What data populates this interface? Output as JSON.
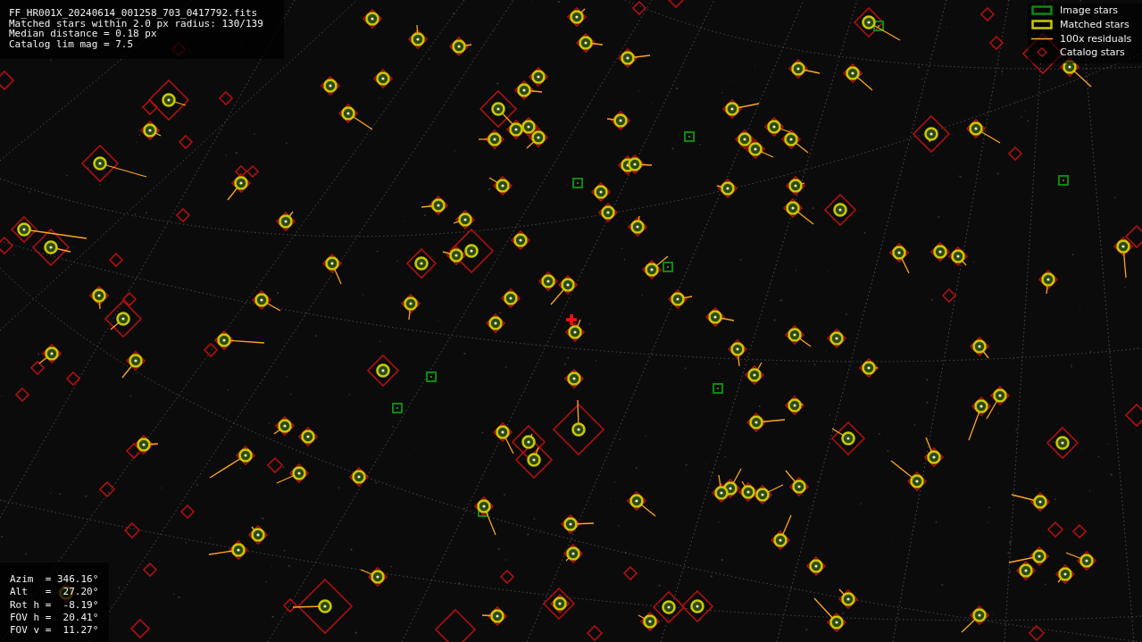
{
  "info": {
    "lines": [
      "FF_HR001X_20240614_001258_703_0417792.fits",
      "Matched stars within 2.0 px radius: 130/139",
      "Median distance = 0.18 px",
      "Catalog lim mag = 7.5"
    ]
  },
  "legend": [
    {
      "kind": "image",
      "label": "Image stars"
    },
    {
      "kind": "matched",
      "label": "Matched stars"
    },
    {
      "kind": "residual",
      "label": "100x residuals"
    },
    {
      "kind": "catalog",
      "label": "Catalog stars"
    }
  ],
  "pointing": {
    "lines": [
      "Azim  = 346.16°",
      "Alt   =  27.20°",
      "Rot h =  -8.19°",
      "FOV h =  20.41°",
      "FOV v =  11.27°"
    ]
  }
}
